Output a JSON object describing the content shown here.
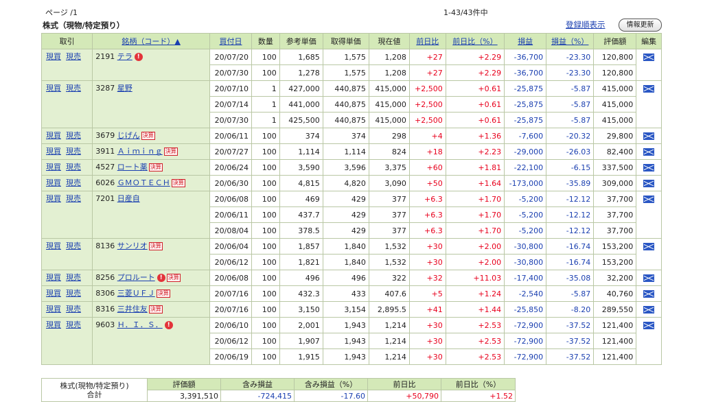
{
  "header": {
    "page_label": "ページ /1",
    "count_label": "1-43/43件中",
    "title": "株式（現物/特定預り）",
    "registration_order": "登録順表示",
    "refresh_button": "情報更新"
  },
  "columns": [
    "取引",
    "銘柄（コード）▲",
    "買付日",
    "数量",
    "参考単価",
    "取得単価",
    "現在値",
    "前日比",
    "前日比（%）",
    "損益",
    "損益（%）",
    "評価額",
    "編集"
  ],
  "actions": {
    "buy": "現買",
    "sell": "現売"
  },
  "badges": {
    "warn": "!",
    "kessan": "決算"
  },
  "groups": [
    {
      "code": "2191",
      "name": "テラ",
      "warn": true,
      "kessan": false,
      "rows": [
        [
          "20/07/20",
          "100",
          "1,685",
          "1,575",
          "1,208",
          "+27",
          "+2.29",
          "-36,700",
          "-23.30",
          "120,800"
        ],
        [
          "20/07/30",
          "100",
          "1,278",
          "1,575",
          "1,208",
          "+27",
          "+2.29",
          "-36,700",
          "-23.30",
          "120,800"
        ]
      ]
    },
    {
      "code": "3287",
      "name": "星野",
      "warn": false,
      "kessan": false,
      "rows": [
        [
          "20/07/10",
          "1",
          "427,000",
          "440,875",
          "415,000",
          "+2,500",
          "+0.61",
          "-25,875",
          "-5.87",
          "415,000"
        ],
        [
          "20/07/14",
          "1",
          "441,000",
          "440,875",
          "415,000",
          "+2,500",
          "+0.61",
          "-25,875",
          "-5.87",
          "415,000"
        ],
        [
          "20/07/30",
          "1",
          "425,500",
          "440,875",
          "415,000",
          "+2,500",
          "+0.61",
          "-25,875",
          "-5.87",
          "415,000"
        ]
      ]
    },
    {
      "code": "3679",
      "name": "じげん",
      "warn": false,
      "kessan": true,
      "rows": [
        [
          "20/06/11",
          "100",
          "374",
          "374",
          "298",
          "+4",
          "+1.36",
          "-7,600",
          "-20.32",
          "29,800"
        ]
      ]
    },
    {
      "code": "3911",
      "name": "Ａｉｍｉｎｇ",
      "warn": false,
      "kessan": true,
      "rows": [
        [
          "20/07/27",
          "100",
          "1,114",
          "1,114",
          "824",
          "+18",
          "+2.23",
          "-29,000",
          "-26.03",
          "82,400"
        ]
      ]
    },
    {
      "code": "4527",
      "name": "ロート薬",
      "warn": false,
      "kessan": true,
      "rows": [
        [
          "20/06/24",
          "100",
          "3,590",
          "3,596",
          "3,375",
          "+60",
          "+1.81",
          "-22,100",
          "-6.15",
          "337,500"
        ]
      ]
    },
    {
      "code": "6026",
      "name": "ＧＭＯＴＥＣＨ",
      "warn": false,
      "kessan": true,
      "rows": [
        [
          "20/06/30",
          "100",
          "4,815",
          "4,820",
          "3,090",
          "+50",
          "+1.64",
          "-173,000",
          "-35.89",
          "309,000"
        ]
      ]
    },
    {
      "code": "7201",
      "name": "日産自",
      "warn": false,
      "kessan": false,
      "rows": [
        [
          "20/06/08",
          "100",
          "469",
          "429",
          "377",
          "+6.3",
          "+1.70",
          "-5,200",
          "-12.12",
          "37,700"
        ],
        [
          "20/06/11",
          "100",
          "437.7",
          "429",
          "377",
          "+6.3",
          "+1.70",
          "-5,200",
          "-12.12",
          "37,700"
        ],
        [
          "20/08/04",
          "100",
          "378.5",
          "429",
          "377",
          "+6.3",
          "+1.70",
          "-5,200",
          "-12.12",
          "37,700"
        ]
      ]
    },
    {
      "code": "8136",
      "name": "サンリオ",
      "warn": false,
      "kessan": true,
      "rows": [
        [
          "20/06/04",
          "100",
          "1,857",
          "1,840",
          "1,532",
          "+30",
          "+2.00",
          "-30,800",
          "-16.74",
          "153,200"
        ],
        [
          "20/06/12",
          "100",
          "1,821",
          "1,840",
          "1,532",
          "+30",
          "+2.00",
          "-30,800",
          "-16.74",
          "153,200"
        ]
      ]
    },
    {
      "code": "8256",
      "name": "プロルート",
      "warn": true,
      "kessan": true,
      "rows": [
        [
          "20/06/08",
          "100",
          "496",
          "496",
          "322",
          "+32",
          "+11.03",
          "-17,400",
          "-35.08",
          "32,200"
        ]
      ]
    },
    {
      "code": "8306",
      "name": "三菱ＵＦＪ",
      "warn": false,
      "kessan": true,
      "rows": [
        [
          "20/07/16",
          "100",
          "432.3",
          "433",
          "407.6",
          "+5",
          "+1.24",
          "-2,540",
          "-5.87",
          "40,760"
        ]
      ]
    },
    {
      "code": "8316",
      "name": "三井住友",
      "warn": false,
      "kessan": true,
      "rows": [
        [
          "20/07/16",
          "100",
          "3,150",
          "3,154",
          "2,895.5",
          "+41",
          "+1.44",
          "-25,850",
          "-8.20",
          "289,550"
        ]
      ]
    },
    {
      "code": "9603",
      "name": "Ｈ．Ｉ．Ｓ．",
      "warn": true,
      "kessan": false,
      "rows": [
        [
          "20/06/10",
          "100",
          "2,001",
          "1,943",
          "1,214",
          "+30",
          "+2.53",
          "-72,900",
          "-37.52",
          "121,400"
        ],
        [
          "20/06/12",
          "100",
          "1,907",
          "1,943",
          "1,214",
          "+30",
          "+2.53",
          "-72,900",
          "-37.52",
          "121,400"
        ],
        [
          "20/06/19",
          "100",
          "1,915",
          "1,943",
          "1,214",
          "+30",
          "+2.53",
          "-72,900",
          "-37.52",
          "121,400"
        ]
      ]
    }
  ],
  "summary": {
    "label_line1": "株式(現物/特定預り)",
    "label_line2": "合計",
    "headers": [
      "評価額",
      "含み損益",
      "含み損益（%）",
      "前日比",
      "前日比（%）"
    ],
    "values": [
      "3,391,510",
      "-724,415",
      "-17.60",
      "+50,790",
      "+1.52"
    ]
  },
  "colors": {
    "header_bg": "#d4e9b8",
    "positive": "#e8001c",
    "negative": "#1a3fb0"
  }
}
